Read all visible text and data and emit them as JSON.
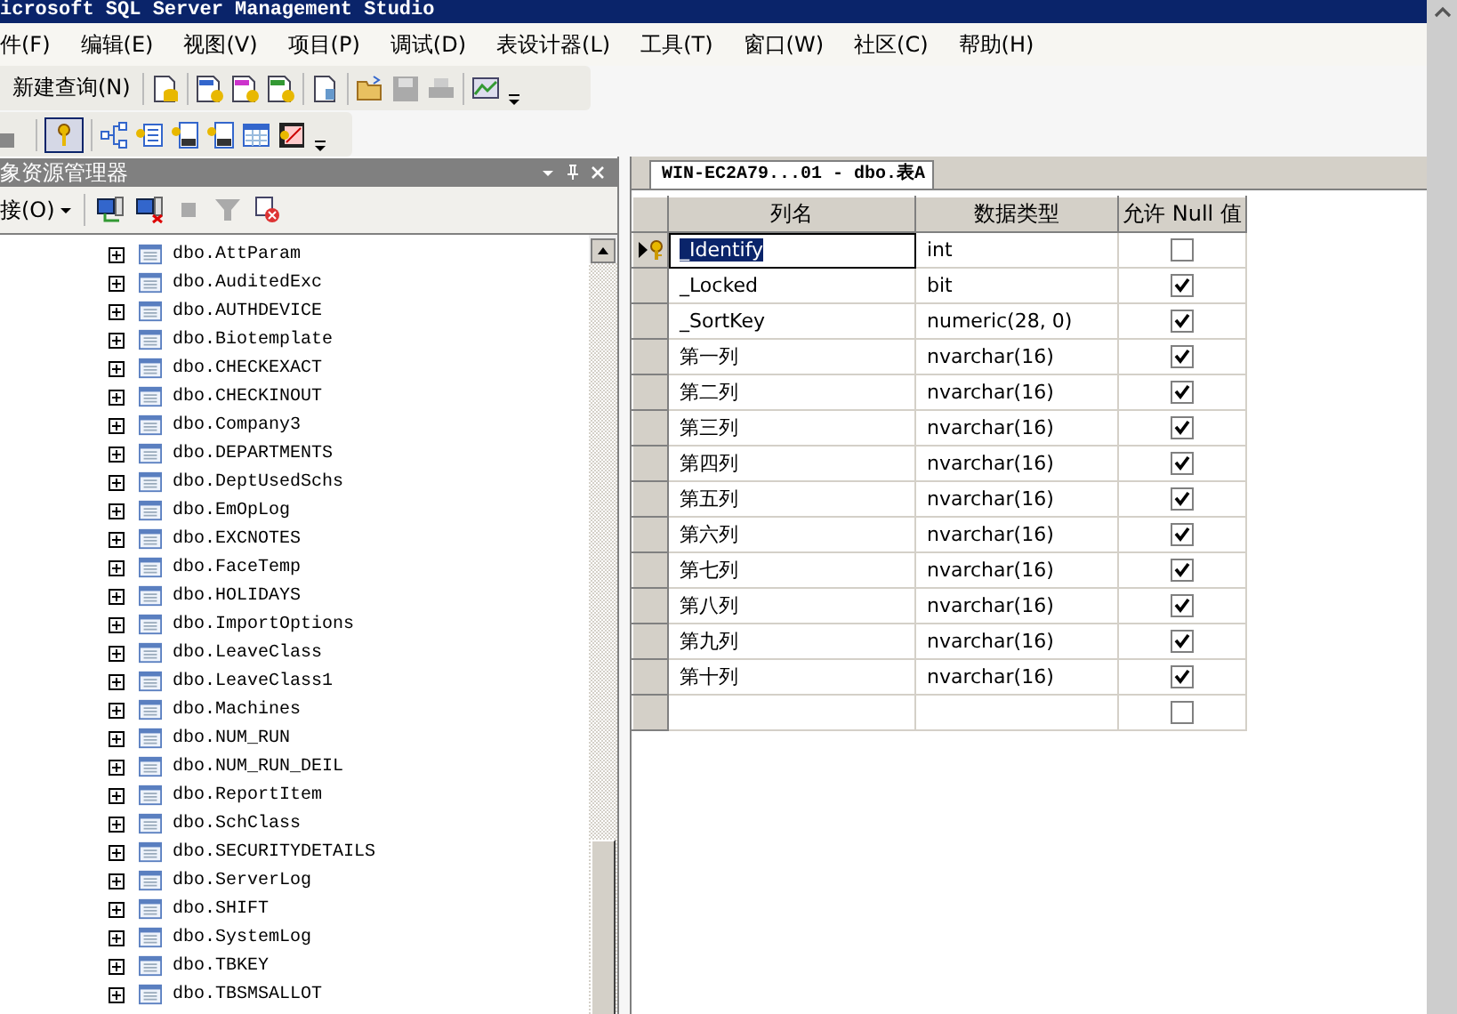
{
  "window": {
    "title": "icrosoft SQL Server Management Studio"
  },
  "menu": [
    "件(F)",
    "编辑(E)",
    "视图(V)",
    "项目(P)",
    "调试(D)",
    "表设计器(L)",
    "工具(T)",
    "窗口(W)",
    "社区(C)",
    "帮助(H)"
  ],
  "toolbar_1": {
    "new_query": "新建查询(N)"
  },
  "toolbar_2": {
    "primary_key_selected": true
  },
  "object_explorer": {
    "title": "象资源管理器",
    "connect": "接(O)",
    "items": [
      {
        "label": "dbo.AttParam",
        "expanded": false
      },
      {
        "label": "dbo.AuditedExc",
        "expanded": false
      },
      {
        "label": "dbo.AUTHDEVICE",
        "expanded": false
      },
      {
        "label": "dbo.Biotemplate",
        "expanded": false
      },
      {
        "label": "dbo.CHECKEXACT",
        "expanded": false
      },
      {
        "label": "dbo.CHECKINOUT",
        "expanded": false
      },
      {
        "label": "dbo.Company3",
        "expanded": false
      },
      {
        "label": "dbo.DEPARTMENTS",
        "expanded": false
      },
      {
        "label": "dbo.DeptUsedSchs",
        "expanded": false
      },
      {
        "label": "dbo.EmOpLog",
        "expanded": false
      },
      {
        "label": "dbo.EXCNOTES",
        "expanded": false
      },
      {
        "label": "dbo.FaceTemp",
        "expanded": false
      },
      {
        "label": "dbo.HOLIDAYS",
        "expanded": false
      },
      {
        "label": "dbo.ImportOptions",
        "expanded": false
      },
      {
        "label": "dbo.LeaveClass",
        "expanded": false
      },
      {
        "label": "dbo.LeaveClass1",
        "expanded": false
      },
      {
        "label": "dbo.Machines",
        "expanded": false
      },
      {
        "label": "dbo.NUM_RUN",
        "expanded": false
      },
      {
        "label": "dbo.NUM_RUN_DEIL",
        "expanded": false
      },
      {
        "label": "dbo.ReportItem",
        "expanded": false
      },
      {
        "label": "dbo.SchClass",
        "expanded": false
      },
      {
        "label": "dbo.SECURITYDETAILS",
        "expanded": false
      },
      {
        "label": "dbo.ServerLog",
        "expanded": false
      },
      {
        "label": "dbo.SHIFT",
        "expanded": false
      },
      {
        "label": "dbo.SystemLog",
        "expanded": false
      },
      {
        "label": "dbo.TBKEY",
        "expanded": false
      },
      {
        "label": "dbo.TBSMSALLOT",
        "expanded": false
      }
    ]
  },
  "document": {
    "tab": "WIN-EC2A79...01 - dbo.表A",
    "columns": [
      "列名",
      "数据类型",
      "允许 Null 值"
    ],
    "rows": [
      {
        "name": "_Identify",
        "type": "int",
        "allow_null": false,
        "primary_key": true,
        "selected": true
      },
      {
        "name": "_Locked",
        "type": "bit",
        "allow_null": true,
        "primary_key": false,
        "selected": false
      },
      {
        "name": "_SortKey",
        "type": "numeric(28, 0)",
        "allow_null": true,
        "primary_key": false,
        "selected": false
      },
      {
        "name": "第一列",
        "type": "nvarchar(16)",
        "allow_null": true,
        "primary_key": false,
        "selected": false
      },
      {
        "name": "第二列",
        "type": "nvarchar(16)",
        "allow_null": true,
        "primary_key": false,
        "selected": false
      },
      {
        "name": "第三列",
        "type": "nvarchar(16)",
        "allow_null": true,
        "primary_key": false,
        "selected": false
      },
      {
        "name": "第四列",
        "type": "nvarchar(16)",
        "allow_null": true,
        "primary_key": false,
        "selected": false
      },
      {
        "name": "第五列",
        "type": "nvarchar(16)",
        "allow_null": true,
        "primary_key": false,
        "selected": false
      },
      {
        "name": "第六列",
        "type": "nvarchar(16)",
        "allow_null": true,
        "primary_key": false,
        "selected": false
      },
      {
        "name": "第七列",
        "type": "nvarchar(16)",
        "allow_null": true,
        "primary_key": false,
        "selected": false
      },
      {
        "name": "第八列",
        "type": "nvarchar(16)",
        "allow_null": true,
        "primary_key": false,
        "selected": false
      },
      {
        "name": "第九列",
        "type": "nvarchar(16)",
        "allow_null": true,
        "primary_key": false,
        "selected": false
      },
      {
        "name": "第十列",
        "type": "nvarchar(16)",
        "allow_null": true,
        "primary_key": false,
        "selected": false
      }
    ],
    "new_row": {
      "allow_null": false
    }
  }
}
